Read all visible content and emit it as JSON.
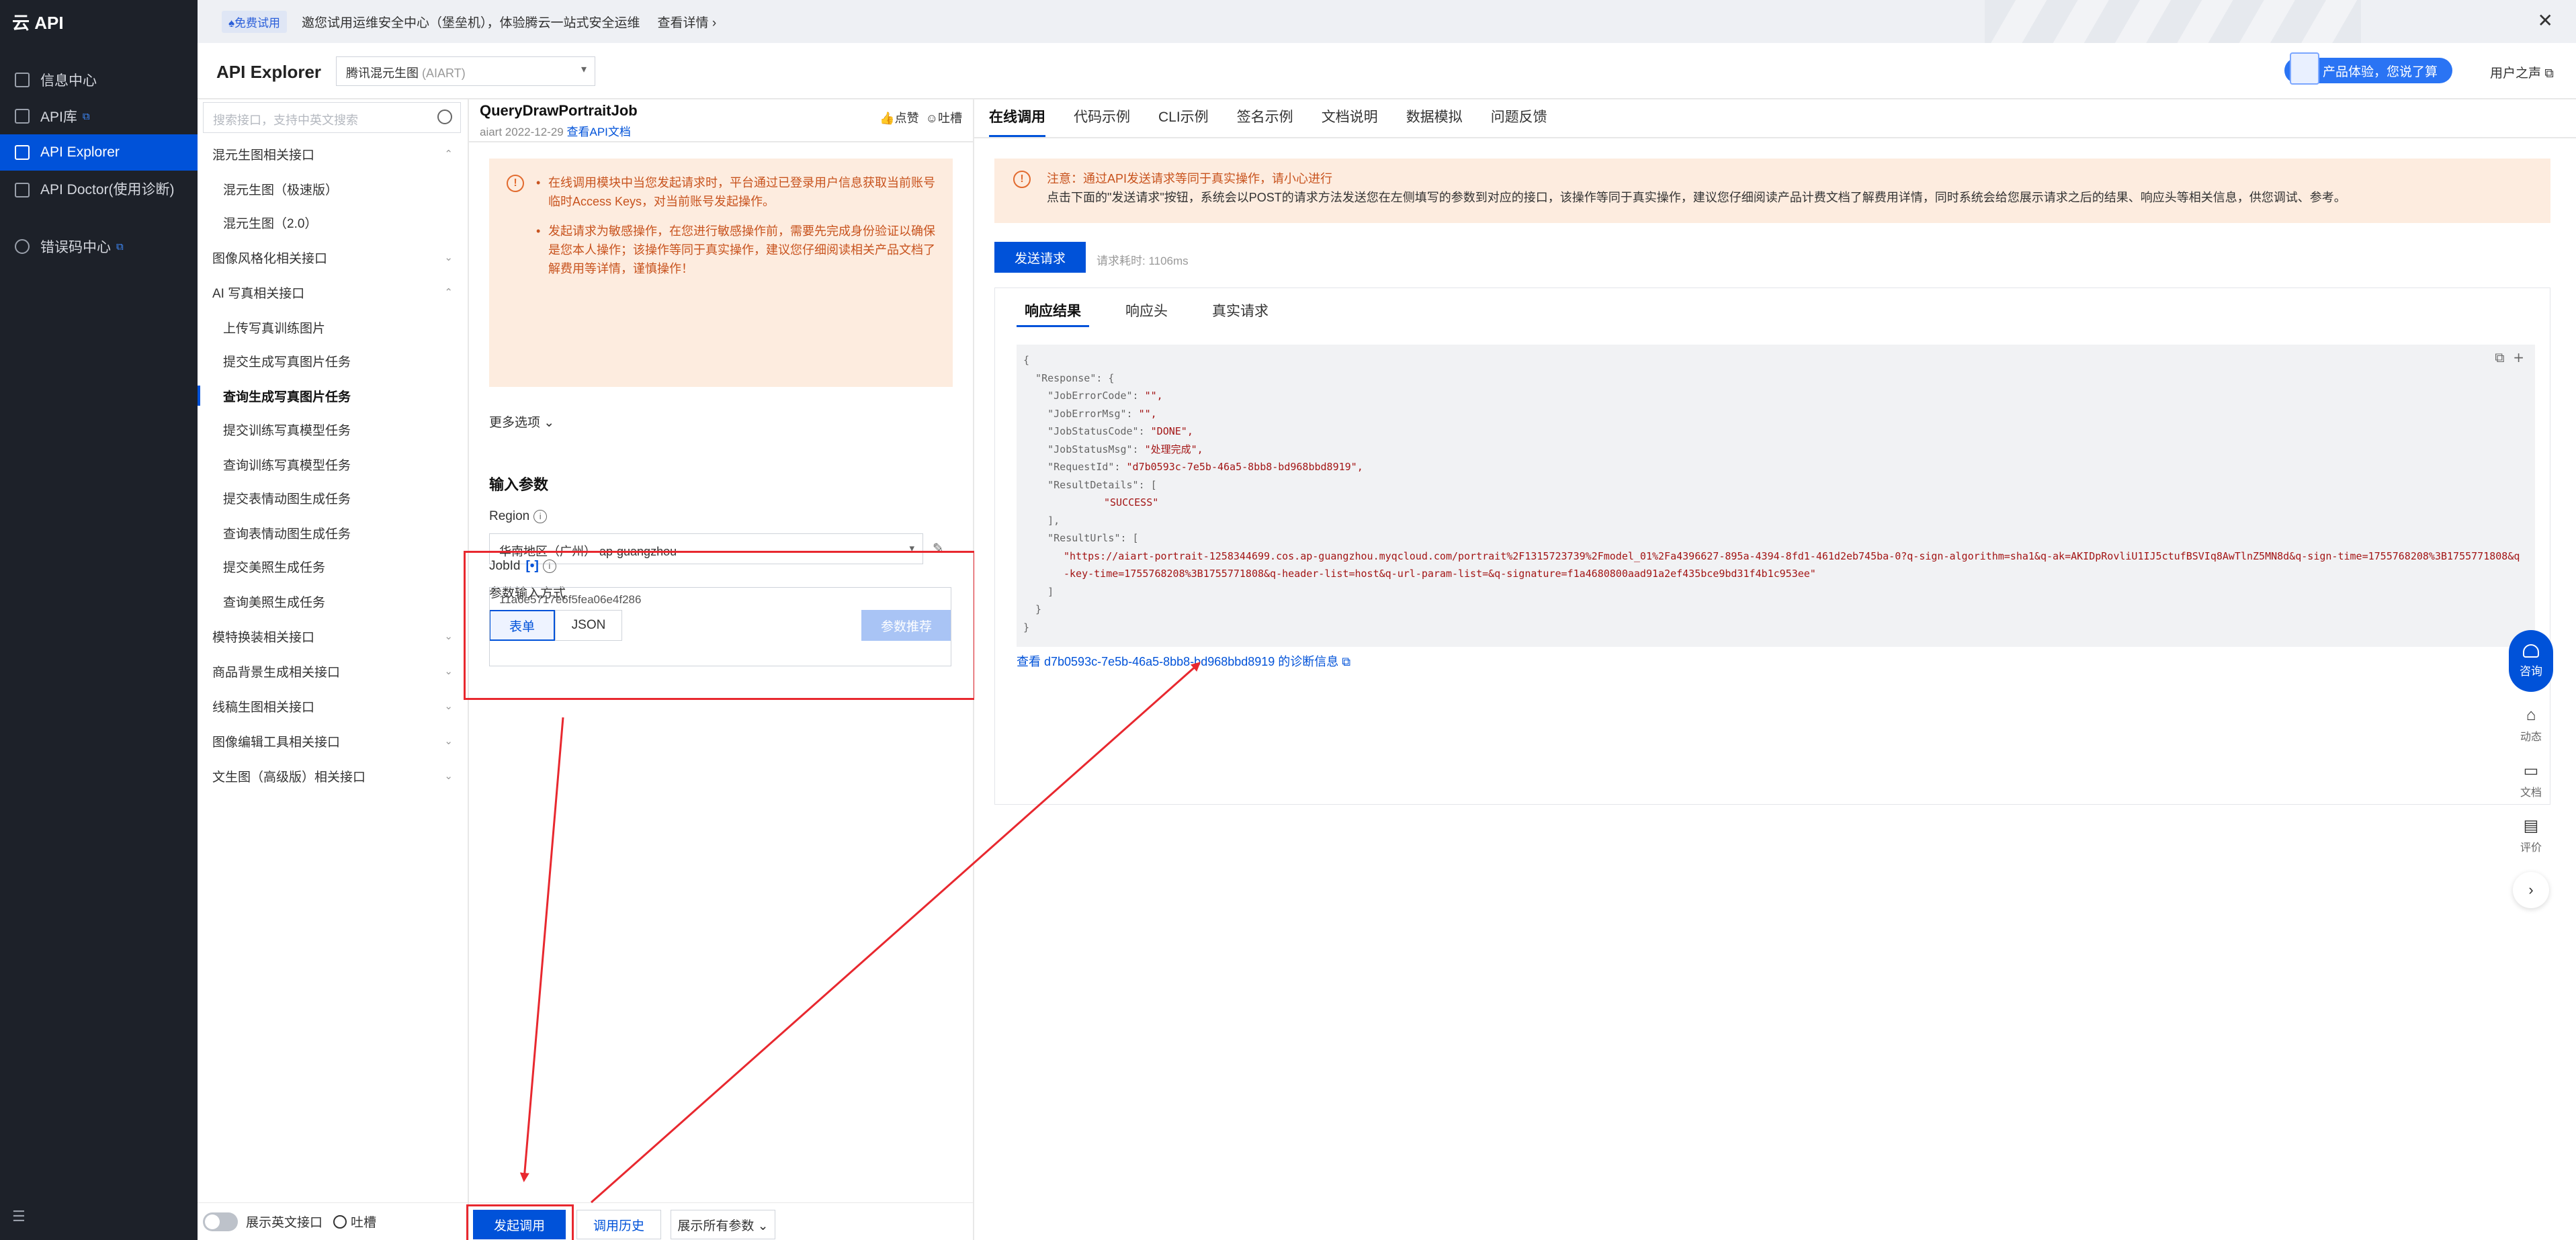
{
  "brand": "云 API",
  "leftnav": {
    "items": [
      {
        "label": "信息中心",
        "icon": "grid-icon",
        "external": false
      },
      {
        "label": "API库",
        "icon": "library-icon",
        "external": true
      },
      {
        "label": "API Explorer",
        "icon": "explorer-icon",
        "external": false
      },
      {
        "label": "API Doctor(使用诊断)",
        "icon": "doctor-icon",
        "external": false
      },
      {
        "label": "错误码中心",
        "icon": "error-code-icon",
        "external": true
      }
    ],
    "collapse_icon": "menu-collapse-icon"
  },
  "banner": {
    "tag": "♠免费试用",
    "text": "邀您试用运维安全中心（堡垒机），体验腾云一站式安全运维",
    "detail": "查看详情 ›",
    "close": "✕"
  },
  "header": {
    "title": "API Explorer",
    "product": "腾讯混元生图",
    "product_code": "(AIART)",
    "promo": "产品体验，您说了算",
    "voice": "用户之声 ⧉"
  },
  "catalog": {
    "search_placeholder": "搜索接口，支持中英文搜索",
    "items": [
      {
        "label": "混元生图相关接口",
        "kind": "group",
        "chev": "⌃"
      },
      {
        "label": "混元生图（极速版）",
        "kind": "sub"
      },
      {
        "label": "混元生图（2.0）",
        "kind": "sub"
      },
      {
        "label": "图像风格化相关接口",
        "kind": "group",
        "chev": "⌄"
      },
      {
        "label": "AI 写真相关接口",
        "kind": "group",
        "chev": "⌃"
      },
      {
        "label": "上传写真训练图片",
        "kind": "sub"
      },
      {
        "label": "提交生成写真图片任务",
        "kind": "sub"
      },
      {
        "label": "查询生成写真图片任务",
        "kind": "sub",
        "current": true
      },
      {
        "label": "提交训练写真模型任务",
        "kind": "sub"
      },
      {
        "label": "查询训练写真模型任务",
        "kind": "sub"
      },
      {
        "label": "提交表情动图生成任务",
        "kind": "sub"
      },
      {
        "label": "查询表情动图生成任务",
        "kind": "sub"
      },
      {
        "label": "提交美照生成任务",
        "kind": "sub"
      },
      {
        "label": "查询美照生成任务",
        "kind": "sub"
      },
      {
        "label": "模特换装相关接口",
        "kind": "group",
        "chev": "⌄"
      },
      {
        "label": "商品背景生成相关接口",
        "kind": "group",
        "chev": "⌄"
      },
      {
        "label": "线稿生图相关接口",
        "kind": "group",
        "chev": "⌄"
      },
      {
        "label": "图像编辑工具相关接口",
        "kind": "group",
        "chev": "⌄"
      },
      {
        "label": "文生图（高级版）相关接口",
        "kind": "group",
        "chev": "⌄"
      }
    ],
    "footer_toggle": "展示英文接口",
    "footer_feedback": "吐槽"
  },
  "params": {
    "api_name": "QueryDrawPortraitJob",
    "api_meta": "aiart 2022-12-29",
    "api_doc_link": "查看API文档",
    "like": "点赞",
    "complain": "吐槽",
    "warnings": [
      "在线调用模块中当您发起请求时，平台通过已登录用户信息获取当前账号临时Access Keys，对当前账号发起操作。",
      "发起请求为敏感操作，在您进行敏感操作前，需要先完成身份验证以确保是您本人操作；该操作等同于真实操作，建议您仔细阅读相关产品文档了解费用等详情，谨慎操作！"
    ],
    "more_options": "更多选项 ⌄",
    "input_title": "输入参数",
    "region_label": "Region",
    "region_value": "华南地区（广州） ap-guangzhou",
    "mode_label": "参数输入方式",
    "mode_form": "表单",
    "mode_json": "JSON",
    "recommend": "参数推荐",
    "jobid_label": "JobId",
    "jobid_required": "[•]",
    "jobid_value": "11a6e5717e6f5fea06e4f286",
    "send_button": "发起调用",
    "history_button": "调用历史",
    "all_params": "展示所有参数 ⌄"
  },
  "right": {
    "tabs": [
      "在线调用",
      "代码示例",
      "CLI示例",
      "签名示例",
      "文档说明",
      "数据模拟",
      "问题反馈"
    ],
    "notice_line1": "注意：通过API发送请求等同于真实操作，请小心进行",
    "notice_line2": "点击下面的\"发送请求\"按钮，系统会以POST的请求方法发送您在左侧填写的参数到对应的接口，该操作等同于真实操作，建议您仔细阅读产品计费文档了解费用详情，同时系统会给您展示请求之后的结果、响应头等相关信息，供您调试、参考。",
    "send": "发送请求",
    "elapsed": "请求耗时: 1106ms",
    "resp_tabs": [
      "响应结果",
      "响应头",
      "真实请求"
    ],
    "code": {
      "l01": "{",
      "l02": "  \"Response\": {",
      "l03k": "    \"JobErrorCode\": ",
      "l03v": "\"\",",
      "l04k": "    \"JobErrorMsg\": ",
      "l04v": "\"\",",
      "l05k": "    \"JobStatusCode\": ",
      "l05v": "\"DONE\",",
      "l06k": "    \"JobStatusMsg\": ",
      "l06v": "\"处理完成\",",
      "l07k": "    \"RequestId\": ",
      "l07v": "\"d7b0593c-7e5b-46a5-8bb8-bd968bbd8919\",",
      "l08": "    \"ResultDetails\": [",
      "l09": "\"SUCCESS\"",
      "l10": "    ],",
      "l11": "    \"ResultUrls\": [",
      "url": "\"https://aiart-portrait-1258344699.cos.ap-guangzhou.myqcloud.com/portrait%2F1315723739%2Fmodel_01%2Fa4396627-895a-4394-8fd1-461d2eb745ba-0?q-sign-algorithm=sha1&q-ak=AKIDpRovliU1IJ5ctufBSVIq8AwTlnZ5MN8d&q-sign-time=1755768208%3B1755771808&q-key-time=1755768208%3B1755771808&q-header-list=host&q-url-param-list=&q-signature=f1a4680800aad91a2ef435bce9bd31f4b1c953ee\"",
      "l13": "    ]",
      "l14": "  }",
      "l15": "}"
    },
    "diag_link": "查看 d7b0593c-7e5b-46a5-8bb8-bd968bbd8919 的诊断信息 ⧉"
  },
  "floater": {
    "consult": "咨询",
    "dynamic": "动态",
    "docs": "文档",
    "review": "评价",
    "next": "›"
  }
}
